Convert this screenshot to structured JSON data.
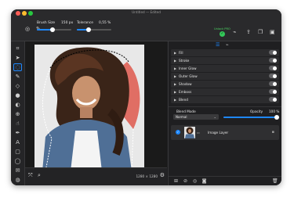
{
  "window": {
    "title": "Untitled — Edited"
  },
  "toolbar": {
    "brush_size_label": "Brush Size",
    "brush_size_value": "150 px",
    "brush_size_level": 0.45,
    "tolerance_label": "Tolerance",
    "tolerance_value": "0,55 %",
    "tolerance_level": 0.35,
    "unlock_label": "Unlock PRO"
  },
  "tools": [
    "crop-icon",
    "arrow-select-icon",
    "lasso-select-icon",
    "brush-icon",
    "eraser-icon",
    "drop-icon",
    "gradient-icon",
    "stamp-icon",
    "smudge-icon",
    "pen-icon",
    "text-icon",
    "shape-icon",
    "circle-icon",
    "sponge-icon",
    "dodge-icon"
  ],
  "effects": [
    {
      "label": "Fill"
    },
    {
      "label": "Stroke"
    },
    {
      "label": "Inner Glow"
    },
    {
      "label": "Outer Glow"
    },
    {
      "label": "Shadow"
    },
    {
      "label": "Emboss"
    },
    {
      "label": "Blend"
    }
  ],
  "blend": {
    "label": "Blend Mode",
    "value": "Normal"
  },
  "opacity": {
    "label": "Opacity",
    "value": "100 %",
    "level": 1.0
  },
  "layer": {
    "name": "Image Layer"
  },
  "status": {
    "dimensions": "1280 × 1280"
  },
  "colors": {
    "accent": "#1e88ff",
    "unlock": "#34c759"
  }
}
